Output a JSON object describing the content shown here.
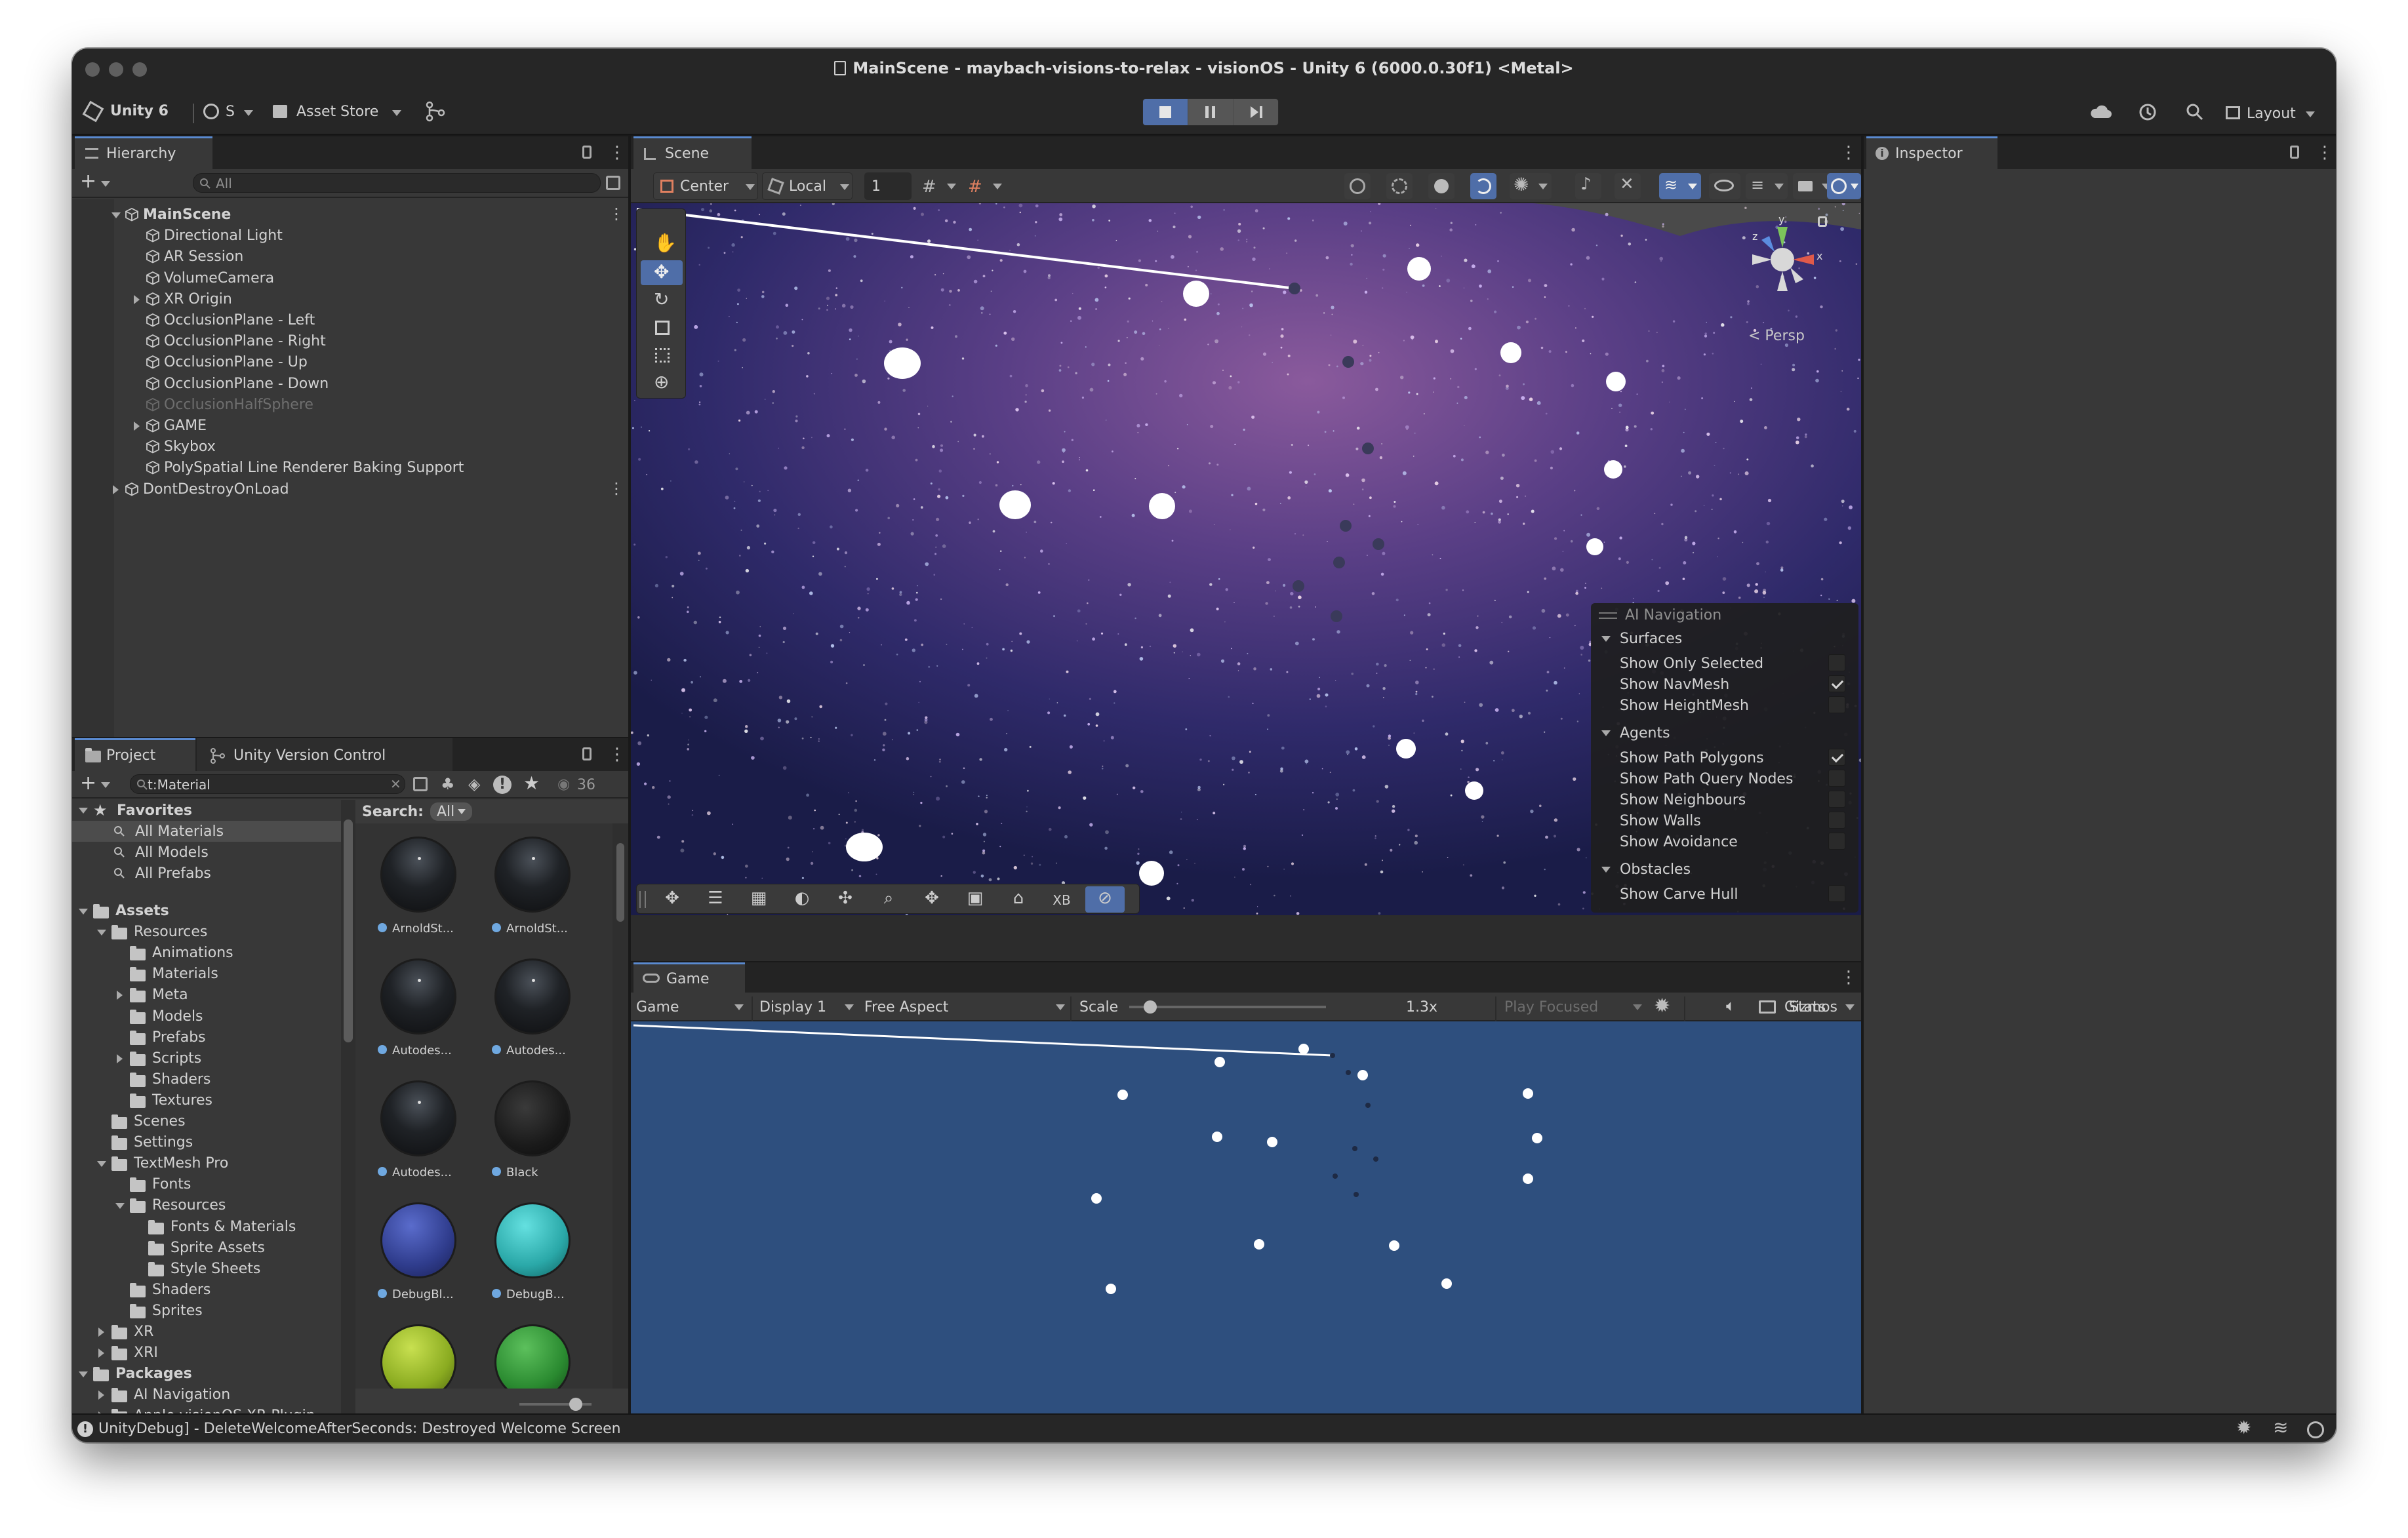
{
  "window": {
    "title": "MainScene - maybach-visions-to-relax - visionOS - Unity 6 (6000.0.30f1) <Metal>"
  },
  "toolbar": {
    "account": "Unity 6",
    "user": "S",
    "asset_store": "Asset Store",
    "layout": "Layout"
  },
  "hierarchy": {
    "tab": "Hierarchy",
    "search_placeholder": "All",
    "items": [
      {
        "label": "MainScene",
        "depth": 0,
        "expanded": true,
        "bold": true
      },
      {
        "label": "Directional Light",
        "depth": 1
      },
      {
        "label": "AR Session",
        "depth": 1
      },
      {
        "label": "VolumeCamera",
        "depth": 1
      },
      {
        "label": "XR Origin",
        "depth": 1,
        "collapsed": true
      },
      {
        "label": "OcclusionPlane - Left",
        "depth": 1
      },
      {
        "label": "OcclusionPlane - Right",
        "depth": 1
      },
      {
        "label": "OcclusionPlane - Up",
        "depth": 1
      },
      {
        "label": "OcclusionPlane - Down",
        "depth": 1
      },
      {
        "label": "OcclusionHalfSphere",
        "depth": 1,
        "disabled": true
      },
      {
        "label": "GAME",
        "depth": 1,
        "collapsed": true
      },
      {
        "label": "Skybox",
        "depth": 1
      },
      {
        "label": "PolySpatial Line Renderer Baking Support",
        "depth": 1
      },
      {
        "label": "DontDestroyOnLoad",
        "depth": 0,
        "collapsed": true
      }
    ]
  },
  "project": {
    "tabs": [
      "Project",
      "Unity Version Control"
    ],
    "search_value": "t:Material",
    "count": "36",
    "search_label": "Search:",
    "search_scope": "All",
    "favorites": {
      "label": "Favorites",
      "items": [
        "All Materials",
        "All Models",
        "All Prefabs"
      ]
    },
    "tree": [
      {
        "label": "Assets",
        "depth": 0,
        "bold": true,
        "expanded": true
      },
      {
        "label": "Resources",
        "depth": 1,
        "expanded": true
      },
      {
        "label": "Animations",
        "depth": 2
      },
      {
        "label": "Materials",
        "depth": 2
      },
      {
        "label": "Meta",
        "depth": 2,
        "collapsed": true
      },
      {
        "label": "Models",
        "depth": 2
      },
      {
        "label": "Prefabs",
        "depth": 2
      },
      {
        "label": "Scripts",
        "depth": 2,
        "collapsed": true
      },
      {
        "label": "Shaders",
        "depth": 2
      },
      {
        "label": "Textures",
        "depth": 2
      },
      {
        "label": "Scenes",
        "depth": 1
      },
      {
        "label": "Settings",
        "depth": 1
      },
      {
        "label": "TextMesh Pro",
        "depth": 1,
        "expanded": true
      },
      {
        "label": "Fonts",
        "depth": 2
      },
      {
        "label": "Resources",
        "depth": 2,
        "expanded": true
      },
      {
        "label": "Fonts & Materials",
        "depth": 3
      },
      {
        "label": "Sprite Assets",
        "depth": 3
      },
      {
        "label": "Style Sheets",
        "depth": 3
      },
      {
        "label": "Shaders",
        "depth": 2
      },
      {
        "label": "Sprites",
        "depth": 2
      },
      {
        "label": "XR",
        "depth": 1,
        "collapsed": true
      },
      {
        "label": "XRI",
        "depth": 1,
        "collapsed": true
      },
      {
        "label": "Packages",
        "depth": 0,
        "bold": true,
        "expanded": true
      },
      {
        "label": "AI Navigation",
        "depth": 1,
        "collapsed": true
      },
      {
        "label": "Apple visionOS XR Plugin",
        "depth": 1,
        "collapsed": true
      }
    ],
    "assets": [
      {
        "label": "ArnoldSt...",
        "style": "dark"
      },
      {
        "label": "ArnoldSt...",
        "style": "dark"
      },
      {
        "label": "Autodes...",
        "style": "dark"
      },
      {
        "label": "Autodes...",
        "style": "dark"
      },
      {
        "label": "Autodes...",
        "style": "dark"
      },
      {
        "label": "Black",
        "style": "black"
      },
      {
        "label": "DebugBl...",
        "style": "blue"
      },
      {
        "label": "DebugB...",
        "style": "cyan"
      },
      {
        "label": "",
        "style": "lime"
      },
      {
        "label": "",
        "style": "green"
      }
    ]
  },
  "scene": {
    "tab": "Scene",
    "pivot": "Center",
    "space": "Local",
    "grid_value": "1",
    "gizmo_label": "< Persp",
    "overlay_xb": "XB"
  },
  "ai_navigation": {
    "title": "AI Navigation",
    "sections": [
      {
        "header": "Surfaces",
        "items": [
          {
            "label": "Show Only Selected",
            "checked": false
          },
          {
            "label": "Show NavMesh",
            "checked": true
          },
          {
            "label": "Show HeightMesh",
            "checked": false
          }
        ]
      },
      {
        "header": "Agents",
        "items": [
          {
            "label": "Show Path Polygons",
            "checked": true
          },
          {
            "label": "Show Path Query Nodes",
            "checked": false
          },
          {
            "label": "Show Neighbours",
            "checked": false
          },
          {
            "label": "Show Walls",
            "checked": false
          },
          {
            "label": "Show Avoidance",
            "checked": false
          }
        ]
      },
      {
        "header": "Obstacles",
        "items": [
          {
            "label": "Show Carve Hull",
            "checked": false
          }
        ]
      }
    ]
  },
  "game": {
    "tab": "Game",
    "mode": "Game",
    "display": "Display 1",
    "aspect": "Free Aspect",
    "scale_label": "Scale",
    "scale_value": "1.3x",
    "play_mode": "Play Focused",
    "stats": "Stats",
    "gizmos": "Gizmos",
    "background": "#2e4f7e"
  },
  "inspector": {
    "tab": "Inspector"
  },
  "status": {
    "message": "UnityDebug] - DeleteWelcomeAfterSeconds: Destroyed Welcome Screen"
  }
}
